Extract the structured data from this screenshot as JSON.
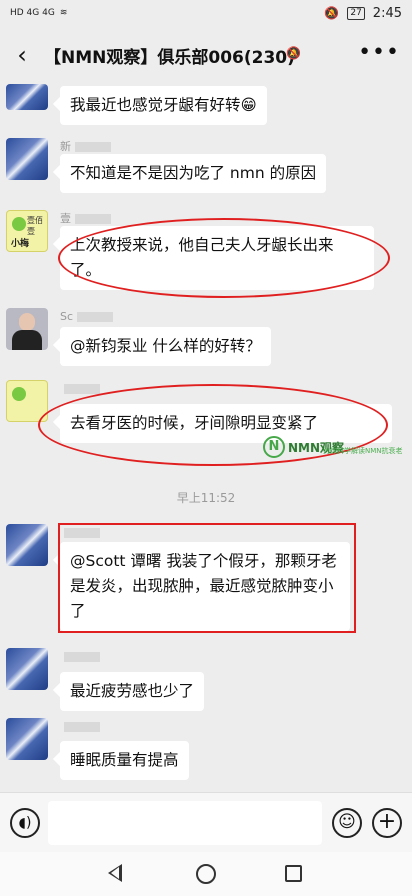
{
  "status_bar": {
    "left_text": "HD 4G 4G",
    "battery": "27",
    "time": "2:45"
  },
  "header": {
    "back_icon": "chevron-left-icon",
    "title": "【NMN观察】俱乐部006(230)",
    "more_icon": "more-icon"
  },
  "messages": [
    {
      "sender": "",
      "text": "我最近也感觉牙龈有好转😁"
    },
    {
      "sender": "新",
      "text": "不知道是不是因为吃了 nmn 的原因"
    },
    {
      "sender": "壹",
      "text": "上次教授来说，他自己夫人牙龈长出来了。"
    },
    {
      "sender": "Sc",
      "text": "@新钧泵业  什么样的好转？"
    },
    {
      "sender": "",
      "text": "去看牙医的时候，牙间隙明显变紧了"
    },
    {
      "sender": "",
      "text": "@Scott 谭曙  我装了个假牙，那颗牙老是发炎，出现脓肿，最近感觉脓肿变小了"
    },
    {
      "sender": "",
      "text": "最近疲劳感也少了"
    },
    {
      "sender": "",
      "text": "睡眠质量有提高"
    }
  ],
  "timestamp": "早上11:52",
  "avatars": {
    "壹佰壹": "壹佰壹",
    "小梅": "小梅"
  },
  "watermark": {
    "brand": "NMN观察",
    "sub": "为你科学解读NMN抗衰老"
  },
  "input_bar": {
    "placeholder": ""
  },
  "colors": {
    "background": "#ededed",
    "bubble": "#ffffff",
    "annotation": "#e02020"
  }
}
